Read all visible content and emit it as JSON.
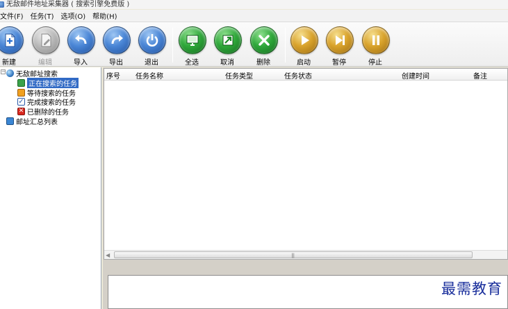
{
  "window": {
    "title": "无敌邮件地址采集器 ( 搜索引擎免费版 )"
  },
  "menu": [
    {
      "label": "文件(F)"
    },
    {
      "label": "任务(T)"
    },
    {
      "label": "选项(O)"
    },
    {
      "label": "帮助(H)"
    }
  ],
  "toolbar": {
    "new": {
      "label": "新建",
      "icon": "new-doc-icon"
    },
    "edit": {
      "label": "编辑",
      "icon": "edit-doc-icon",
      "enabled": false
    },
    "import": {
      "label": "导入",
      "icon": "import-arrow-icon"
    },
    "export": {
      "label": "导出",
      "icon": "export-arrow-icon"
    },
    "exit": {
      "label": "退出",
      "icon": "power-icon"
    },
    "select_all": {
      "label": "全选",
      "icon": "monitor-icon"
    },
    "cancel": {
      "label": "取消",
      "icon": "diagonal-arrows-icon"
    },
    "delete": {
      "label": "删除",
      "icon": "x-icon"
    },
    "start": {
      "label": "启动",
      "icon": "play-icon"
    },
    "pause": {
      "label": "暂停",
      "icon": "next-icon"
    },
    "stop": {
      "label": "停止",
      "icon": "pause-icon"
    }
  },
  "tree": {
    "root": {
      "label": "无敌邮址搜索",
      "icon": "globe-icon"
    },
    "children": [
      {
        "label": "正在搜索的任务",
        "icon": "search-task-icon",
        "selected": true
      },
      {
        "label": "等待搜索的任务",
        "icon": "waiting-task-icon"
      },
      {
        "label": "完成搜索的任务",
        "icon": "checkbox-icon"
      },
      {
        "label": "已删除的任务",
        "icon": "deleted-icon"
      }
    ],
    "summary": {
      "label": "邮址汇总列表",
      "icon": "list-icon"
    }
  },
  "grid": {
    "columns": [
      "序号",
      "任务名称",
      "任务类型",
      "任务状态",
      "创建时间",
      "备注"
    ],
    "rows": []
  },
  "watermark": "最需教育",
  "colors": {
    "selection": "#316ac5",
    "watermark": "#1a2f9c"
  }
}
